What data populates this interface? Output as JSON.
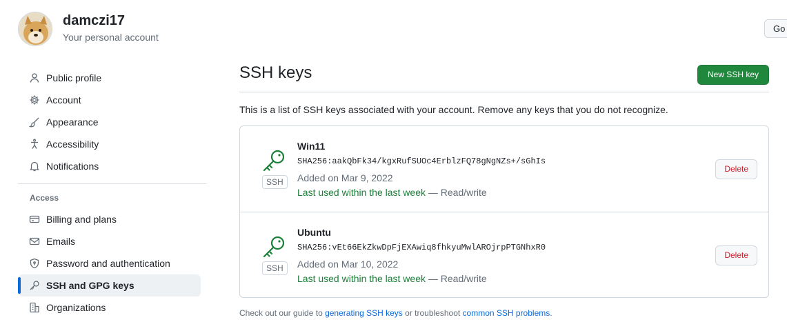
{
  "account": {
    "name": "damczi17",
    "subtitle": "Your personal account",
    "go_button": "Go"
  },
  "sidebar": {
    "items": [
      {
        "label": "Public profile",
        "icon": "person-icon"
      },
      {
        "label": "Account",
        "icon": "gear-icon"
      },
      {
        "label": "Appearance",
        "icon": "paintbrush-icon"
      },
      {
        "label": "Accessibility",
        "icon": "accessibility-icon"
      },
      {
        "label": "Notifications",
        "icon": "bell-icon"
      }
    ],
    "access_title": "Access",
    "access_items": [
      {
        "label": "Billing and plans",
        "icon": "credit-card-icon"
      },
      {
        "label": "Emails",
        "icon": "mail-icon"
      },
      {
        "label": "Password and authentication",
        "icon": "shield-lock-icon"
      },
      {
        "label": "SSH and GPG keys",
        "icon": "key-icon",
        "active": true
      },
      {
        "label": "Organizations",
        "icon": "organization-icon"
      }
    ]
  },
  "main": {
    "title": "SSH keys",
    "new_button": "New SSH key",
    "intro": "This is a list of SSH keys associated with your account. Remove any keys that you do not recognize.",
    "keys": [
      {
        "name": "Win11",
        "fingerprint": "SHA256:aakQbFk34/kgxRufSUOc4ErblzFQ78gNgNZs+/sGhIs",
        "added": "Added on Mar 9, 2022",
        "last_used": "Last used within the last week",
        "access": " — Read/write",
        "badge": "SSH",
        "delete_label": "Delete"
      },
      {
        "name": "Ubuntu",
        "fingerprint": "SHA256:vEt66EkZkwDpFjEXAwiq8fhkyuMwlAROjrpPTGNhxR0",
        "added": "Added on Mar 10, 2022",
        "last_used": "Last used within the last week",
        "access": " — Read/write",
        "badge": "SSH",
        "delete_label": "Delete"
      }
    ],
    "footer": {
      "prefix": "Check out our guide to ",
      "link1": "generating SSH keys",
      "middle": " or troubleshoot ",
      "link2": "common SSH problems",
      "suffix": "."
    }
  },
  "colors": {
    "primary_button": "#1f883d",
    "accent": "#0969da",
    "danger": "#cf222e",
    "success_text": "#1a7f37"
  }
}
